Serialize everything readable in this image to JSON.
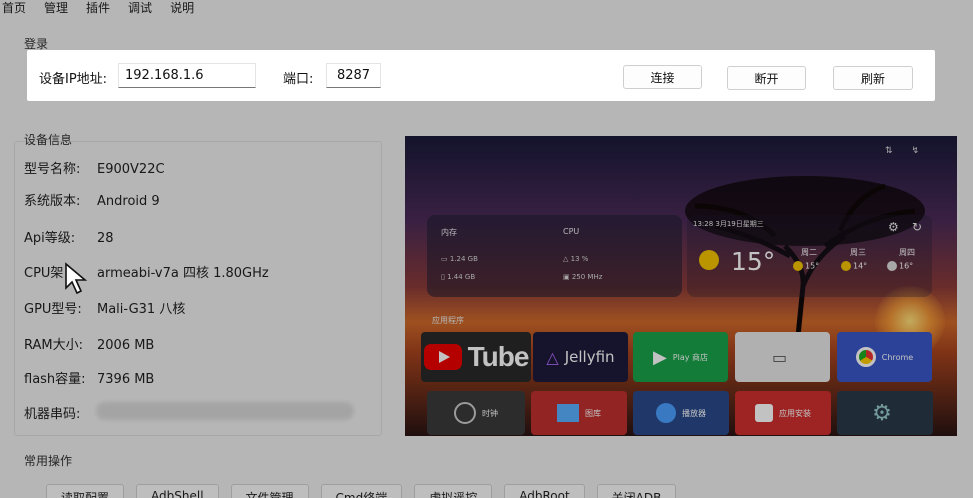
{
  "tabs": [
    "首页",
    "管理",
    "插件",
    "调试",
    "说明"
  ],
  "login": {
    "section": "登录",
    "ip_label": "设备IP地址:",
    "ip_value": "192.168.1.6",
    "port_label": "端口:",
    "port_value": "8287",
    "connect": "连接",
    "disconnect": "断开",
    "refresh": "刷新"
  },
  "device_info": {
    "section": "设备信息",
    "rows": [
      {
        "key": "型号名称:",
        "value": "E900V22C"
      },
      {
        "key": "系统版本:",
        "value": "Android 9"
      },
      {
        "key": "Api等级:",
        "value": "28"
      },
      {
        "key": "CPU架",
        "value": "armeabi-v7a 四核 1.80GHz"
      },
      {
        "key": "GPU型号:",
        "value": "Mali-G31 八核"
      },
      {
        "key": "RAM大小:",
        "value": "2006 MB"
      },
      {
        "key": "flash容量:",
        "value": "7396 MB"
      },
      {
        "key": "机器串码:",
        "value": ""
      }
    ]
  },
  "screen": {
    "mem_title": "内存",
    "mem_1": "1.24 GB",
    "mem_2": "1.44 GB",
    "cpu_title": "CPU",
    "cpu_1": "13 %",
    "cpu_2": "250 MHz",
    "time": "13:28 3月19日星期三",
    "temp": "15°",
    "forecast": [
      {
        "day": "周二",
        "temp": "15°"
      },
      {
        "day": "周三",
        "temp": "14°"
      },
      {
        "day": "周四",
        "temp": "16°"
      }
    ],
    "apps_label": "应用程序",
    "apps": [
      "Tube",
      "Jellyfin",
      "Play 商店",
      "",
      "Chrome"
    ],
    "apps2": [
      "时钟",
      "图库",
      "播放器",
      "应用安装",
      ""
    ]
  },
  "ops": {
    "section": "常用操作",
    "buttons": [
      "读取配置",
      "AdbShell",
      "文件管理",
      "Cmd终端",
      "虚拟遥控",
      "AdbRoot",
      "关闭ADB"
    ]
  }
}
